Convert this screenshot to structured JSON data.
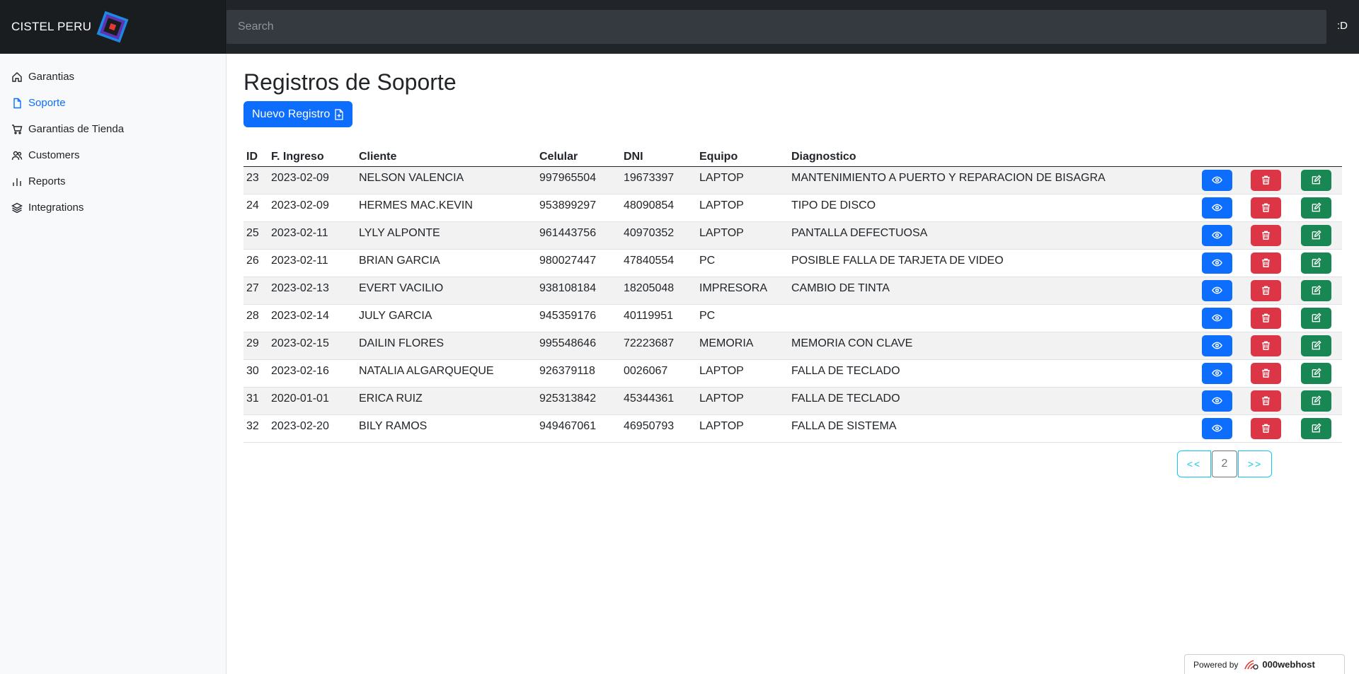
{
  "brand": {
    "name": "CISTEL PERU"
  },
  "search": {
    "placeholder": "Search"
  },
  "header": {
    "user_label": ":D"
  },
  "sidebar": {
    "items": [
      {
        "label": "Garantias",
        "icon": "home-icon",
        "active": false
      },
      {
        "label": "Soporte",
        "icon": "file-icon",
        "active": true
      },
      {
        "label": "Garantias de Tienda",
        "icon": "shopping-cart-icon",
        "active": false
      },
      {
        "label": "Customers",
        "icon": "users-icon",
        "active": false
      },
      {
        "label": "Reports",
        "icon": "bar-chart-icon",
        "active": false
      },
      {
        "label": "Integrations",
        "icon": "layers-icon",
        "active": false
      }
    ]
  },
  "main": {
    "title": "Registros de Soporte",
    "new_button": "Nuevo Registro",
    "columns": [
      "ID",
      "F. Ingreso",
      "Cliente",
      "Celular",
      "DNI",
      "Equipo",
      "Diagnostico"
    ],
    "rows": [
      [
        "23",
        "2023-02-09",
        "NELSON VALENCIA",
        "997965504",
        "19673397",
        "LAPTOP",
        "MANTENIMIENTO A PUERTO Y REPARACION DE BISAGRA"
      ],
      [
        "24",
        "2023-02-09",
        "HERMES MAC.KEVIN",
        "953899297",
        "48090854",
        "LAPTOP",
        "TIPO DE DISCO"
      ],
      [
        "25",
        "2023-02-11",
        "LYLY ALPONTE",
        "961443756",
        "40970352",
        "LAPTOP",
        "PANTALLA DEFECTUOSA"
      ],
      [
        "26",
        "2023-02-11",
        "BRIAN GARCIA",
        "980027447",
        "47840554",
        "PC",
        "POSIBLE FALLA DE TARJETA DE VIDEO"
      ],
      [
        "27",
        "2023-02-13",
        "EVERT VACILIO",
        "938108184",
        "18205048",
        "IMPRESORA",
        "CAMBIO DE TINTA"
      ],
      [
        "28",
        "2023-02-14",
        "JULY GARCIA",
        "945359176",
        "40119951",
        "PC",
        ""
      ],
      [
        "29",
        "2023-02-15",
        "DAILIN FLORES",
        "995548646",
        "72223687",
        "MEMORIA",
        "MEMORIA CON CLAVE"
      ],
      [
        "30",
        "2023-02-16",
        "NATALIA ALGARQUEQUE",
        "926379118",
        "0026067",
        "LAPTOP",
        "FALLA DE TECLADO"
      ],
      [
        "31",
        "2020-01-01",
        "ERICA RUIZ",
        "925313842",
        "45344361",
        "LAPTOP",
        "FALLA DE TECLADO"
      ],
      [
        "32",
        "2023-02-20",
        "BILY RAMOS",
        "949467061",
        "46950793",
        "LAPTOP",
        "FALLA DE SISTEMA"
      ]
    ]
  },
  "pagination": {
    "prev": "<<",
    "current": "2",
    "next": ">>"
  },
  "footer": {
    "powered_by": "Powered by",
    "host": "000webhost"
  },
  "colors": {
    "primary": "#0d6efd",
    "danger": "#dc3545",
    "success": "#198754",
    "info": "#0dcaf0",
    "navbar": "#212529"
  }
}
